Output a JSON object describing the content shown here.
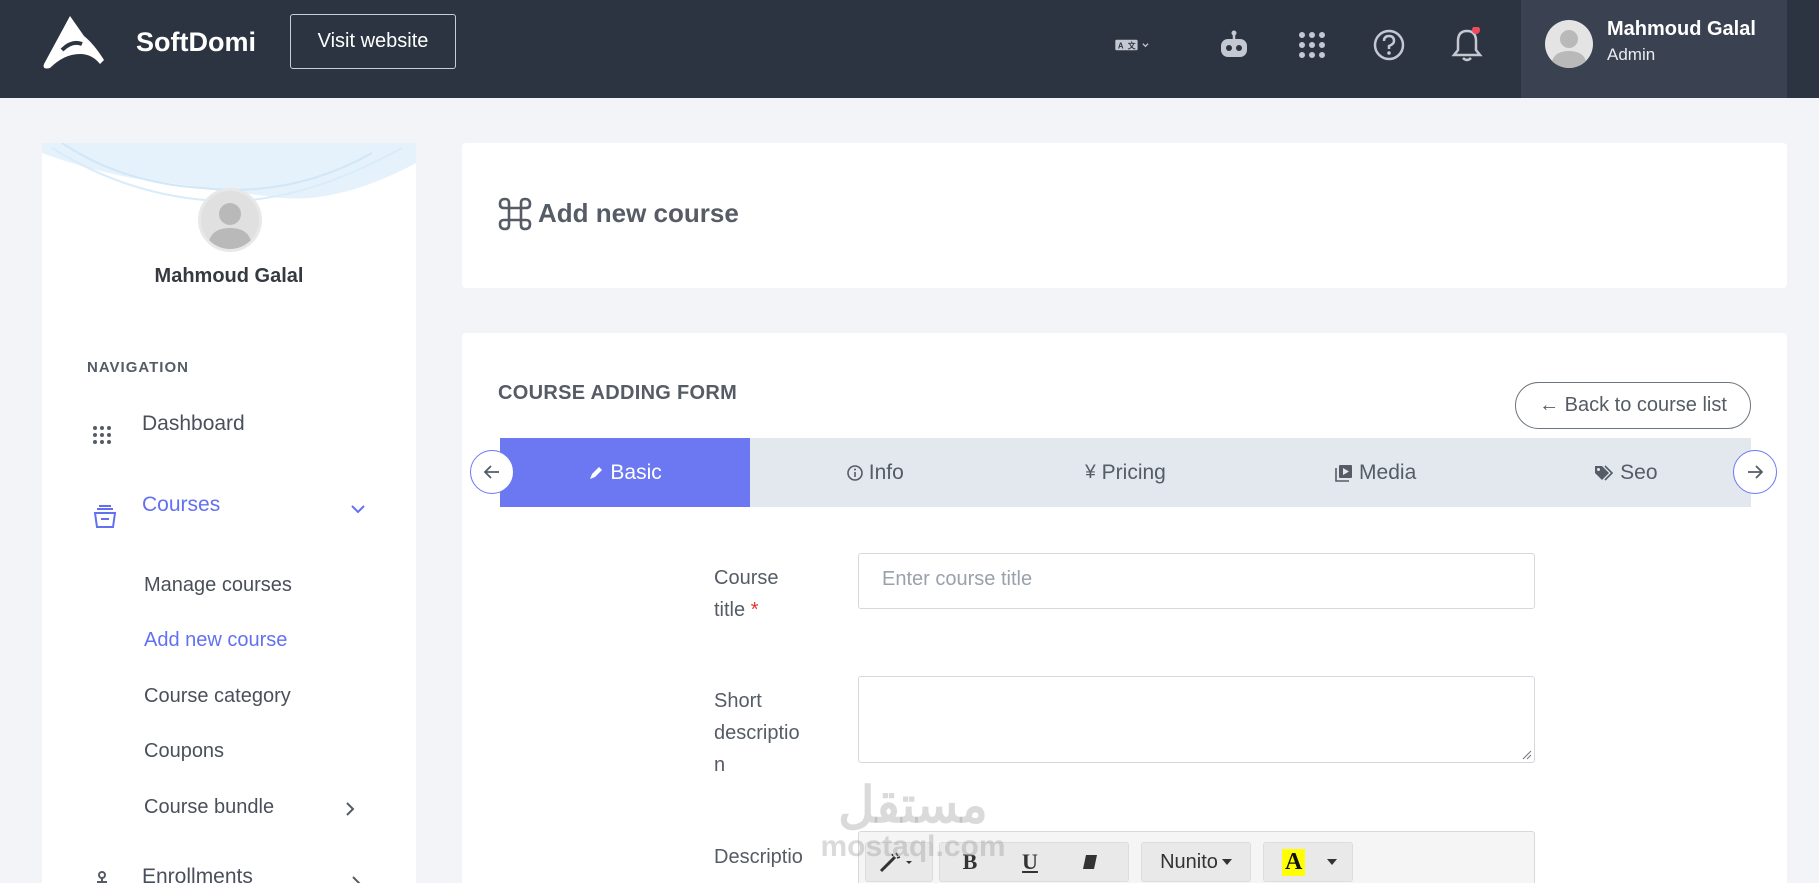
{
  "topbar": {
    "brand": "SoftDomi",
    "visit_label": "Visit website",
    "icons": [
      "translate-icon",
      "robot-icon",
      "apps-grid-icon",
      "help-icon",
      "bell-icon"
    ],
    "user_name": "Mahmoud Galal",
    "user_role": "Admin"
  },
  "sidebar": {
    "profile_name": "Mahmoud Galal",
    "nav_title": "NAVIGATION",
    "items": [
      {
        "label": "Dashboard",
        "icon": "grid-icon"
      },
      {
        "label": "Courses",
        "icon": "courses-icon"
      },
      {
        "label": "Enrollments",
        "icon": "anchor-icon"
      }
    ],
    "sub_items": [
      "Manage courses",
      "Add new course",
      "Course category",
      "Coupons",
      "Course bundle"
    ],
    "active_sub_item": "Add new course"
  },
  "page": {
    "title": "Add new course",
    "form_title": "COURSE ADDING FORM",
    "back_label": "← Back to course list"
  },
  "tabs": [
    {
      "label": "Basic",
      "icon": "pen-icon"
    },
    {
      "label": "Info",
      "icon": "info-icon"
    },
    {
      "label": "Pricing",
      "icon": "yen-icon"
    },
    {
      "label": "Media",
      "icon": "media-icon"
    },
    {
      "label": "Seo",
      "icon": "tags-icon"
    }
  ],
  "form": {
    "course_title_line1": "Course",
    "course_title_line2": "title",
    "required_mark": "*",
    "course_title_placeholder": "Enter course title",
    "short_desc_line1": "Short",
    "short_desc_line2": "descriptio",
    "short_desc_line3": "n",
    "description_label": "Descriptio",
    "editor_font": "Nunito",
    "editor_bold": "B",
    "editor_underline": "U",
    "editor_highlight": "A"
  },
  "watermark": {
    "arabic": "مستقل",
    "latin": "mostaql.com"
  },
  "colors": {
    "accent": "#6b78f2",
    "topbar": "#2d3441",
    "active_link": "#6271f0"
  }
}
